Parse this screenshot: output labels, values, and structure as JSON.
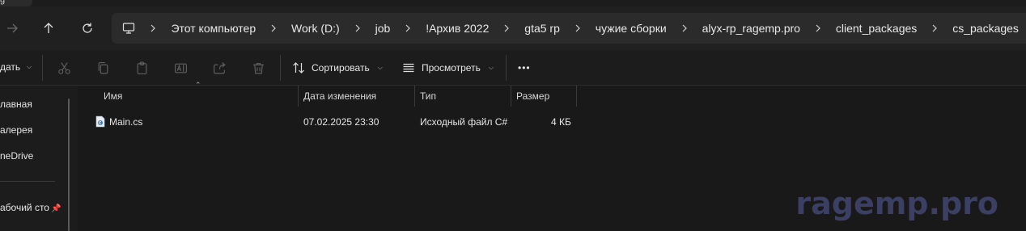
{
  "window": {
    "partial_tab_label": "g"
  },
  "nav": {
    "back": "back-arrow",
    "up": "up-arrow",
    "refresh": "refresh"
  },
  "breadcrumbs": [
    "Этот компьютер",
    "Work (D:)",
    "job",
    "!Архив 2022",
    "gta5 rp",
    "чужие сборки",
    "alyx-rp_ragemp.pro",
    "client_packages",
    "cs_packages"
  ],
  "toolbar": {
    "new_label": "дать",
    "sort_label": "Сортировать",
    "view_label": "Просмотреть",
    "more_label": "•••"
  },
  "sidebar": {
    "items": [
      {
        "label": "лавная"
      },
      {
        "label": "алерея"
      },
      {
        "label": "neDrive"
      },
      {
        "label": "абочий сто"
      }
    ]
  },
  "columns": {
    "name": "Имя",
    "modified": "Дата изменения",
    "type": "Тип",
    "size": "Размер"
  },
  "files": [
    {
      "name": "Main.cs",
      "modified": "07.02.2025 23:30",
      "type": "Исходный файл C#",
      "size": "4 КБ"
    }
  ],
  "watermark": "ragemp.pro",
  "colors": {
    "background": "#191919",
    "address_bar": "#2b2b2b",
    "watermark": "#3a3f63"
  }
}
